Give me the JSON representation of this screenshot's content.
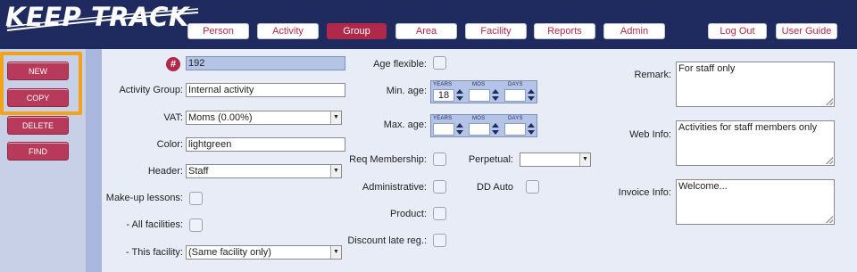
{
  "app": {
    "logo_text": "KEEP TRACK"
  },
  "nav": {
    "items": [
      "Person",
      "Activity",
      "Group",
      "Area",
      "Facility",
      "Reports",
      "Admin"
    ],
    "active": "Group",
    "logout": "Log Out",
    "userguide": "User Guide"
  },
  "actions": {
    "new": "NEW",
    "copy": "COPY",
    "delete": "DELETE",
    "find": "FIND"
  },
  "form": {
    "hash_symbol": "#",
    "id_value": "192",
    "activity_group_label": "Activity Group:",
    "activity_group_value": "Internal activity",
    "vat_label": "VAT:",
    "vat_value": "Moms (0.00%)",
    "color_label": "Color:",
    "color_value": "lightgreen",
    "header_label": "Header:",
    "header_value": "Staff",
    "makeup_label": "Make-up lessons:",
    "all_facilities_label": "- All facilities:",
    "this_facility_label": "- This facility:",
    "this_facility_value": "(Same facility only)",
    "age_flexible_label": "Age flexible:",
    "min_age_label": "Min. age:",
    "max_age_label": "Max. age:",
    "age_headers": [
      "YEARS",
      "MOS",
      "DAYS"
    ],
    "min_age_years": "18",
    "req_membership_label": "Req Membership:",
    "perpetual_label": "Perpetual:",
    "administrative_label": "Administrative:",
    "dd_auto_label": "DD Auto",
    "product_label": "Product:",
    "discount_label": "Discount late reg.:",
    "remark_label": "Remark:",
    "remark_value": "For staff only",
    "webinfo_label": "Web Info:",
    "webinfo_value": "Activities for staff members only",
    "invoice_label": "Invoice Info:",
    "invoice_value": "Welcome..."
  },
  "colors": {
    "header_bg": "#1f2b5e",
    "accent": "#b0284a",
    "highlight": "#f2a31b"
  }
}
